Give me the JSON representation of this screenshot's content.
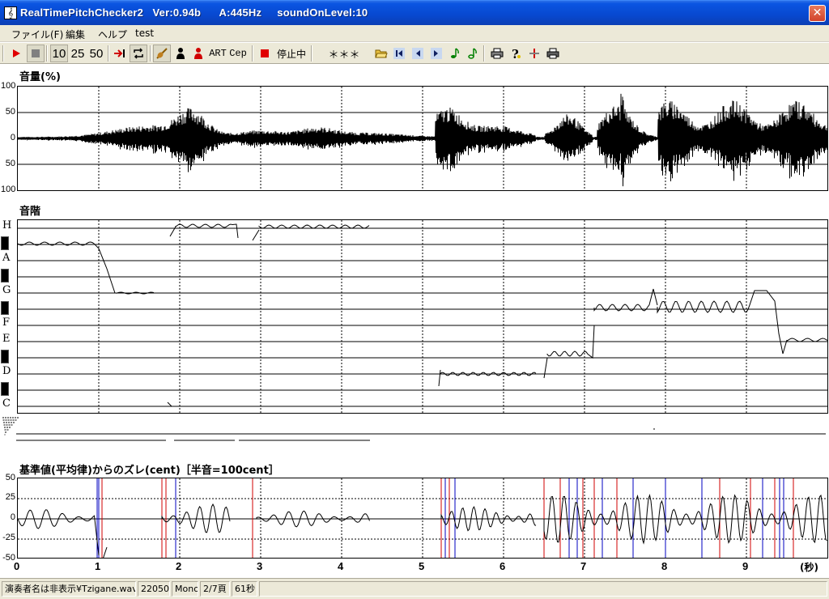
{
  "window": {
    "title": "RealTimePitchChecker2   Ver:0.94b      A:445Hz     soundOnLevel:10",
    "icon": "treble-clef-icon",
    "close_glyph": "✕"
  },
  "menu": [
    "ファイル(F)",
    "編集",
    "ヘルプ",
    "test"
  ],
  "toolbar": {
    "n10": "10",
    "n25": "25",
    "n50": "50",
    "art": "ART",
    "cep": "Cep",
    "stop_state": "停止中",
    "stars": "＊＊＊"
  },
  "volume": {
    "title": "音量(%)",
    "ticks": [
      "100",
      "50",
      "0",
      "50",
      "100"
    ]
  },
  "scale": {
    "title": "音階",
    "notes": [
      "H",
      "A",
      "G",
      "F",
      "E",
      "D",
      "C"
    ]
  },
  "deviation": {
    "title": "基準値(平均律)からのズレ(cent)［半音=100cent］",
    "ticks": [
      "50",
      "25",
      "0",
      "-25",
      "-50"
    ]
  },
  "time_axis": {
    "ticks": [
      "0",
      "1",
      "2",
      "3",
      "4",
      "5",
      "6",
      "7",
      "8",
      "9"
    ],
    "unit": "(秒)"
  },
  "status": {
    "file": "演奏者名は非表示¥Tzigane.wav",
    "rate": "22050",
    "channels": "Mono",
    "page": "2/7頁",
    "duration": "61秒"
  }
}
